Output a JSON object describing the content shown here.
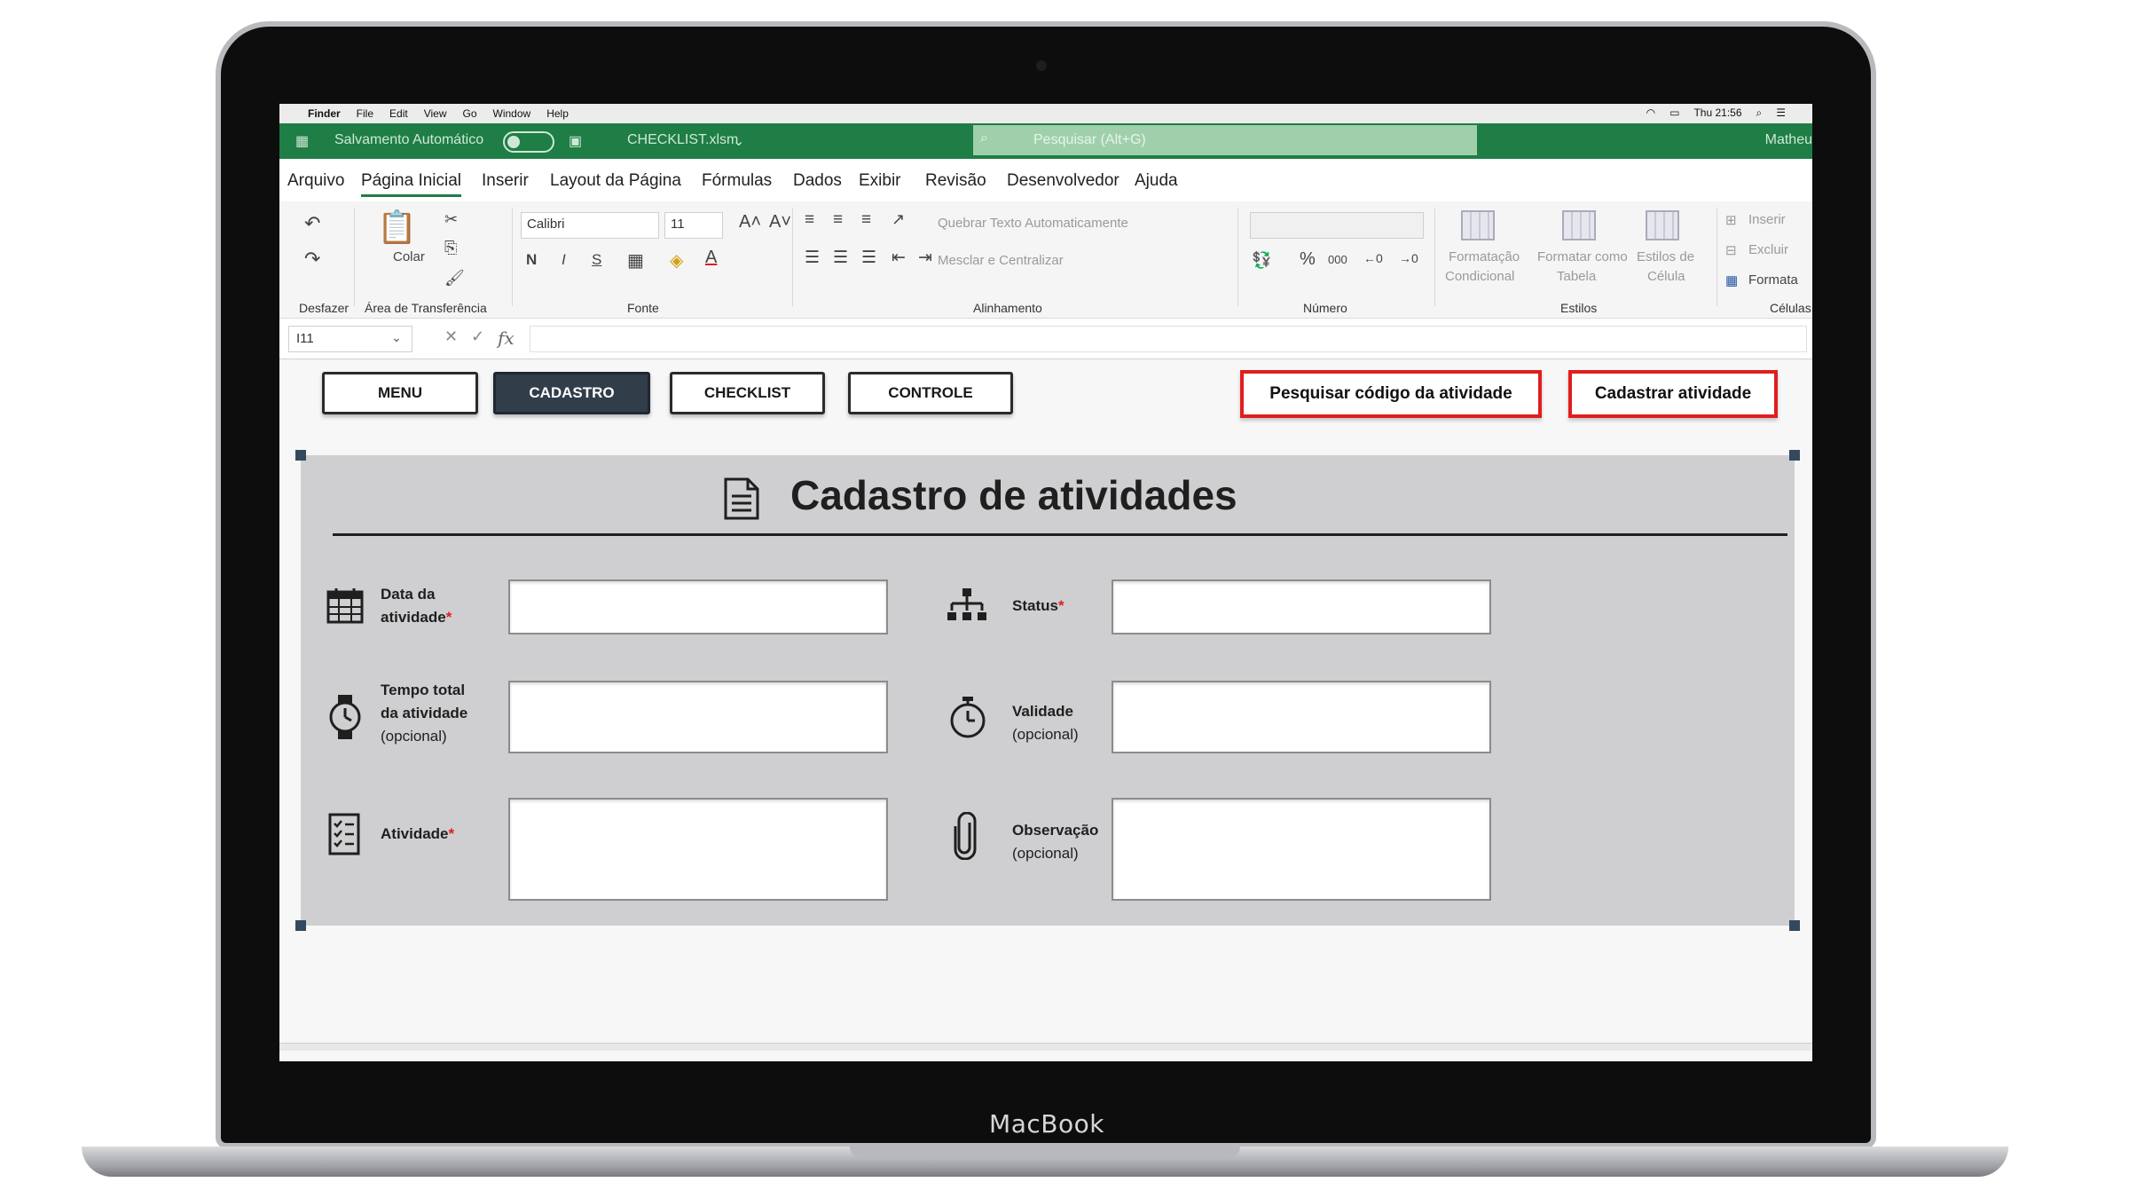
{
  "device": {
    "brand": "MacBook"
  },
  "mac_menu": {
    "apple": "",
    "items": [
      "Finder",
      "File",
      "Edit",
      "View",
      "Go",
      "Window",
      "Help"
    ],
    "clock": "Thu 21:56"
  },
  "titlebar": {
    "autosave": "Salvamento Automático",
    "filename": "CHECKLIST.xlsm",
    "search_placeholder": "Pesquisar (Alt+G)",
    "user": "Matheu"
  },
  "menu_tabs": [
    "Arquivo",
    "Página Inicial",
    "Inserir",
    "Layout da Página",
    "Fórmulas",
    "Dados",
    "Exibir",
    "Revisão",
    "Desenvolvedor",
    "Ajuda"
  ],
  "ribbon": {
    "undo_group": "Desfazer",
    "paste": "Colar",
    "clipboard_group": "Área de Transferência",
    "font_name": "Calibri",
    "font_size": "11",
    "bold": "N",
    "italic": "I",
    "underline": "S",
    "font_group": "Fonte",
    "wrap_text": "Quebrar Texto Automaticamente",
    "merge_center": "Mesclar e Centralizar",
    "alignment_group": "Alinhamento",
    "percent": "%",
    "thousands": "000",
    "number_group": "Número",
    "conditional_format": [
      "Formatação",
      "Condicional"
    ],
    "format_table": [
      "Formatar como",
      "Tabela"
    ],
    "cell_styles": [
      "Estilos de",
      "Célula"
    ],
    "styles_group": "Estilos",
    "insert": "Inserir",
    "delete": "Excluir",
    "format": "Formata",
    "cells_group": "Células"
  },
  "formula_bar": {
    "name_box": "I11",
    "fx": "fx",
    "value": ""
  },
  "sheet": {
    "nav": [
      "MENU",
      "CADASTRO",
      "CHECKLIST",
      "CONTROLE"
    ],
    "actions": {
      "search": "Pesquisar código da atividade",
      "register": "Cadastrar atividade"
    },
    "title": "Cadastro de atividades",
    "fields": {
      "data_line1": "Data da",
      "data_line2": "atividade",
      "tempo_line1": "Tempo total",
      "tempo_line2": "da atividade",
      "tempo_line3": "(opcional)",
      "atividade": "Atividade",
      "status": "Status",
      "validade_line1": "Validade",
      "validade_line2": "(opcional)",
      "observacao_line1": "Observação",
      "observacao_line2": "(opcional)",
      "required_mark": "*"
    }
  },
  "colors": {
    "excel_green": "#1e7e45",
    "active_nav": "#323d4a",
    "action_border": "#e01e1e",
    "panel": "#cfcfd1"
  }
}
